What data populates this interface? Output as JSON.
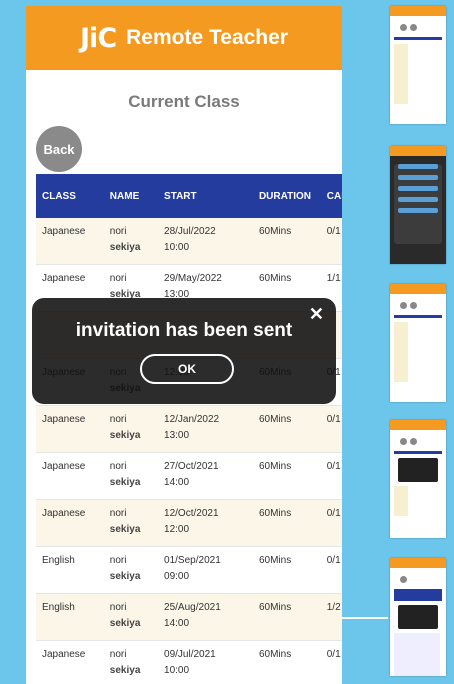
{
  "header": {
    "logo": "JiC",
    "title": "Remote Teacher"
  },
  "page_title": "Current Class",
  "back_label": "Back",
  "table": {
    "columns": [
      "CLASS",
      "NAME",
      "START",
      "DURATION",
      "CAP"
    ],
    "rows": [
      {
        "class": "Japanese",
        "name1": "nori",
        "name2": "sekiya",
        "date": "28/Jul/2022",
        "time": "10:00",
        "duration": "60Mins",
        "cap": "0/1"
      },
      {
        "class": "Japanese",
        "name1": "nori",
        "name2": "sekiya",
        "date": "29/May/2022",
        "time": "13:00",
        "duration": "60Mins",
        "cap": "1/1"
      },
      {
        "class": "",
        "name1": "",
        "name2": "",
        "date": "",
        "time": "",
        "duration": "",
        "cap": ""
      },
      {
        "class": "Japanese",
        "name1": "nori",
        "name2": "sekiya",
        "date": "",
        "time": "12:00",
        "duration": "60Mins",
        "cap": "0/1"
      },
      {
        "class": "Japanese",
        "name1": "nori",
        "name2": "sekiya",
        "date": "12/Jan/2022",
        "time": "13:00",
        "duration": "60Mins",
        "cap": "0/1"
      },
      {
        "class": "Japanese",
        "name1": "nori",
        "name2": "sekiya",
        "date": "27/Oct/2021",
        "time": "14:00",
        "duration": "60Mins",
        "cap": "0/1"
      },
      {
        "class": "Japanese",
        "name1": "nori",
        "name2": "sekiya",
        "date": "12/Oct/2021",
        "time": "12:00",
        "duration": "60Mins",
        "cap": "0/1"
      },
      {
        "class": "English",
        "name1": "nori",
        "name2": "sekiya",
        "date": "01/Sep/2021",
        "time": "09:00",
        "duration": "60Mins",
        "cap": "0/1"
      },
      {
        "class": "English",
        "name1": "nori",
        "name2": "sekiya",
        "date": "25/Aug/2021",
        "time": "14:00",
        "duration": "60Mins",
        "cap": "1/2"
      },
      {
        "class": "Japanese",
        "name1": "nori",
        "name2": "sekiya",
        "date": "09/Jul/2021",
        "time": "10:00",
        "duration": "60Mins",
        "cap": "0/1"
      }
    ]
  },
  "toast": {
    "message": "invitation has been sent",
    "ok_label": "OK",
    "close_symbol": "✕"
  },
  "colors": {
    "header": "#f49a20",
    "table_header": "#233c9e",
    "background": "#6cc6ec"
  }
}
